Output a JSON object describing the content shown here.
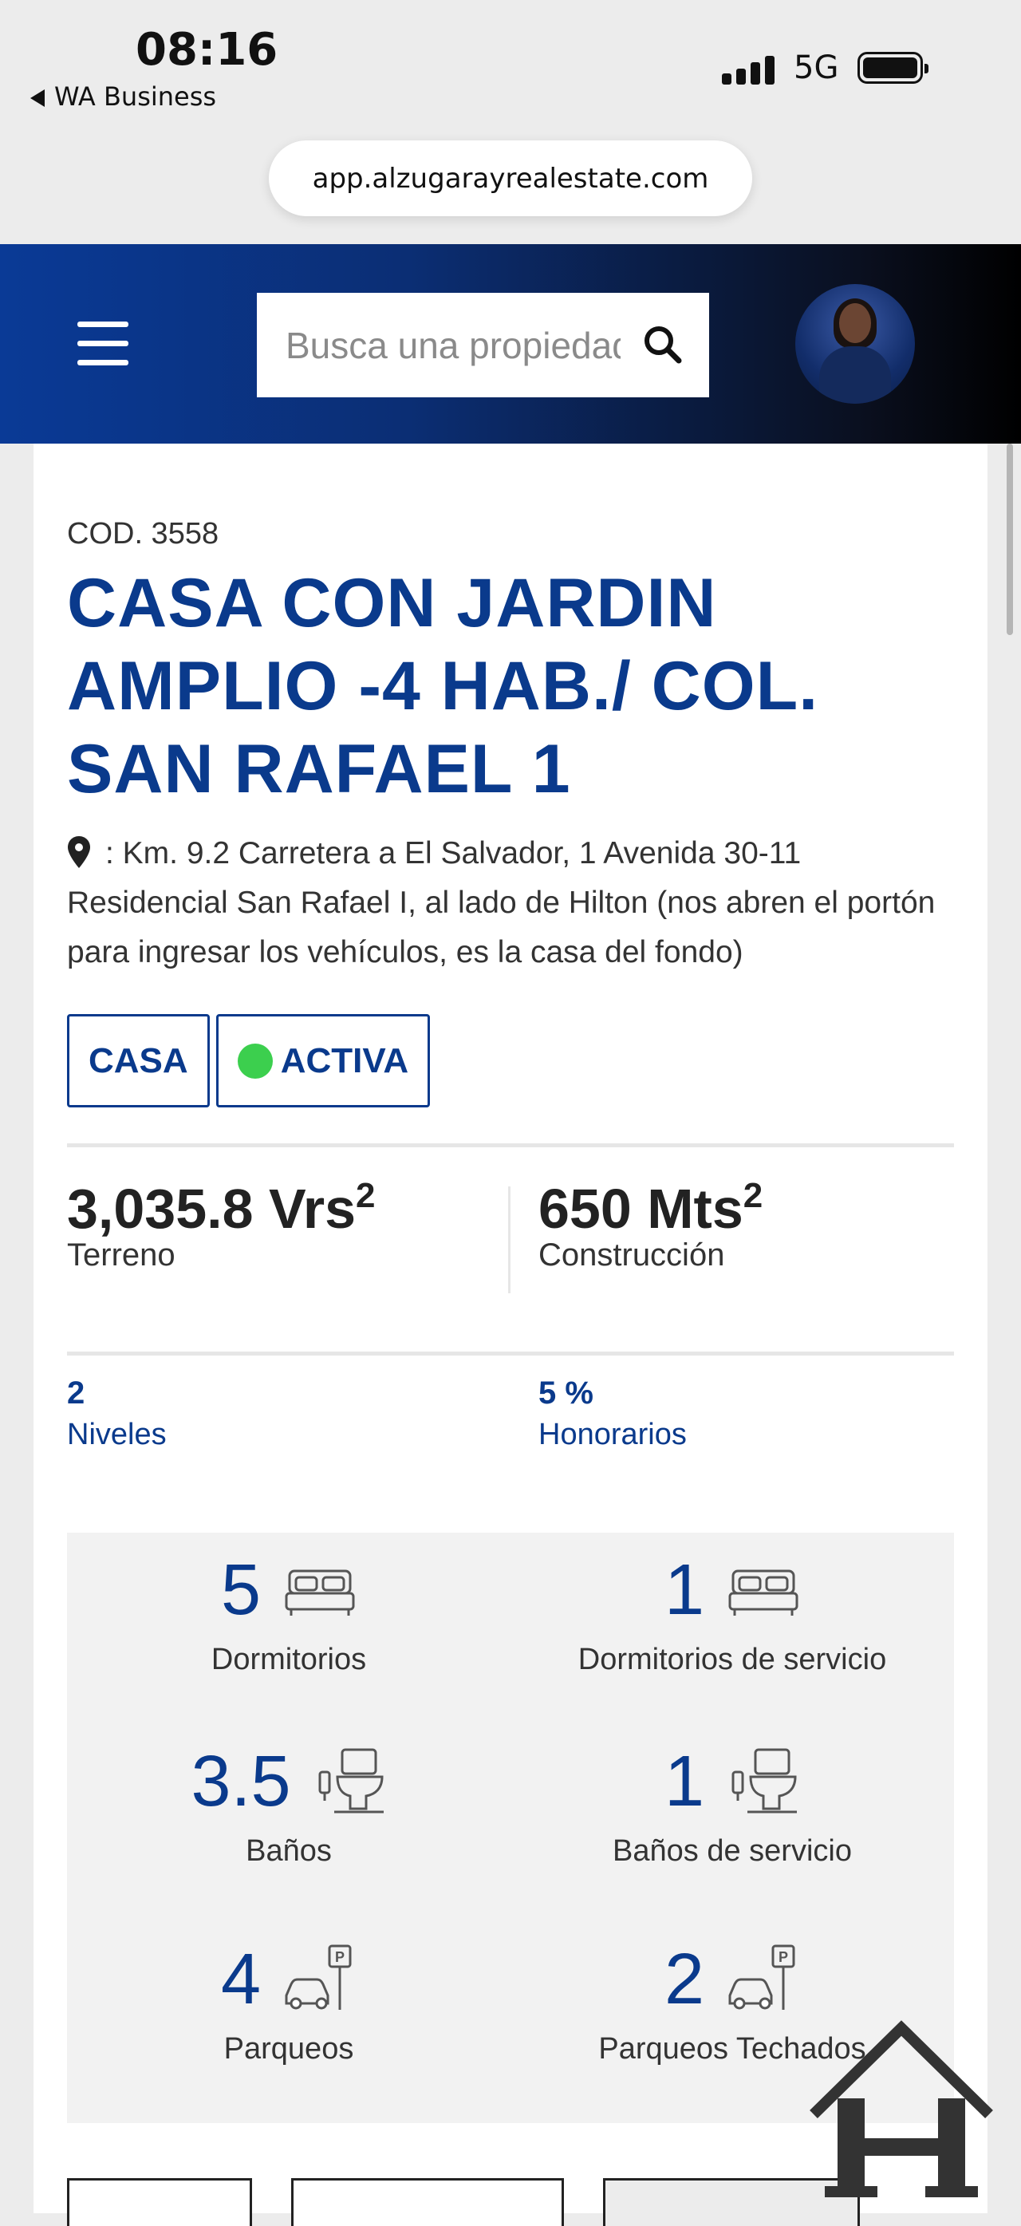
{
  "status_bar": {
    "time": "08:16",
    "back_app": "WA Business",
    "network": "5G"
  },
  "browser": {
    "url": "app.alzugarayrealestate.com"
  },
  "header": {
    "search_placeholder": "Busca una propiedad"
  },
  "listing": {
    "code": "COD. 3558",
    "title": "CASA CON JARDIN AMPLIO -4 HAB./ COL. SAN RAFAEL 1",
    "address": ": Km. 9.2 Carretera a El Salvador, 1 Avenida 30-11 Residencial San Rafael I, al lado de Hilton (nos abren el portón para ingresar los vehículos, es la casa del fondo)",
    "tags": [
      {
        "label": "CASA"
      },
      {
        "label": "ACTIVA",
        "status_color": "#3ccf4e"
      }
    ],
    "land": {
      "value": "3,035.8 Vrs",
      "exp": "2",
      "label": "Terreno"
    },
    "construction": {
      "value": "650 Mts",
      "exp": "2",
      "label": "Construcción"
    },
    "levels": {
      "value": "2",
      "label": "Niveles"
    },
    "fees": {
      "value": "5 %",
      "label": "Honorarios"
    },
    "features": [
      {
        "value": "5",
        "label": "Dormitorios",
        "icon": "bed-icon"
      },
      {
        "value": "1",
        "label": "Dormitorios de servicio",
        "icon": "bed-icon"
      },
      {
        "value": "3.5",
        "label": "Baños",
        "icon": "toilet-icon"
      },
      {
        "value": "1",
        "label": "Baños de servicio",
        "icon": "toilet-icon"
      },
      {
        "value": "4",
        "label": "Parqueos",
        "icon": "parking-car-icon"
      },
      {
        "value": "2",
        "label": "Parqueos Techados",
        "icon": "parking-car-icon"
      }
    ]
  },
  "colors": {
    "brand_blue": "#0a3a8c",
    "status_active": "#3ccf4e"
  }
}
